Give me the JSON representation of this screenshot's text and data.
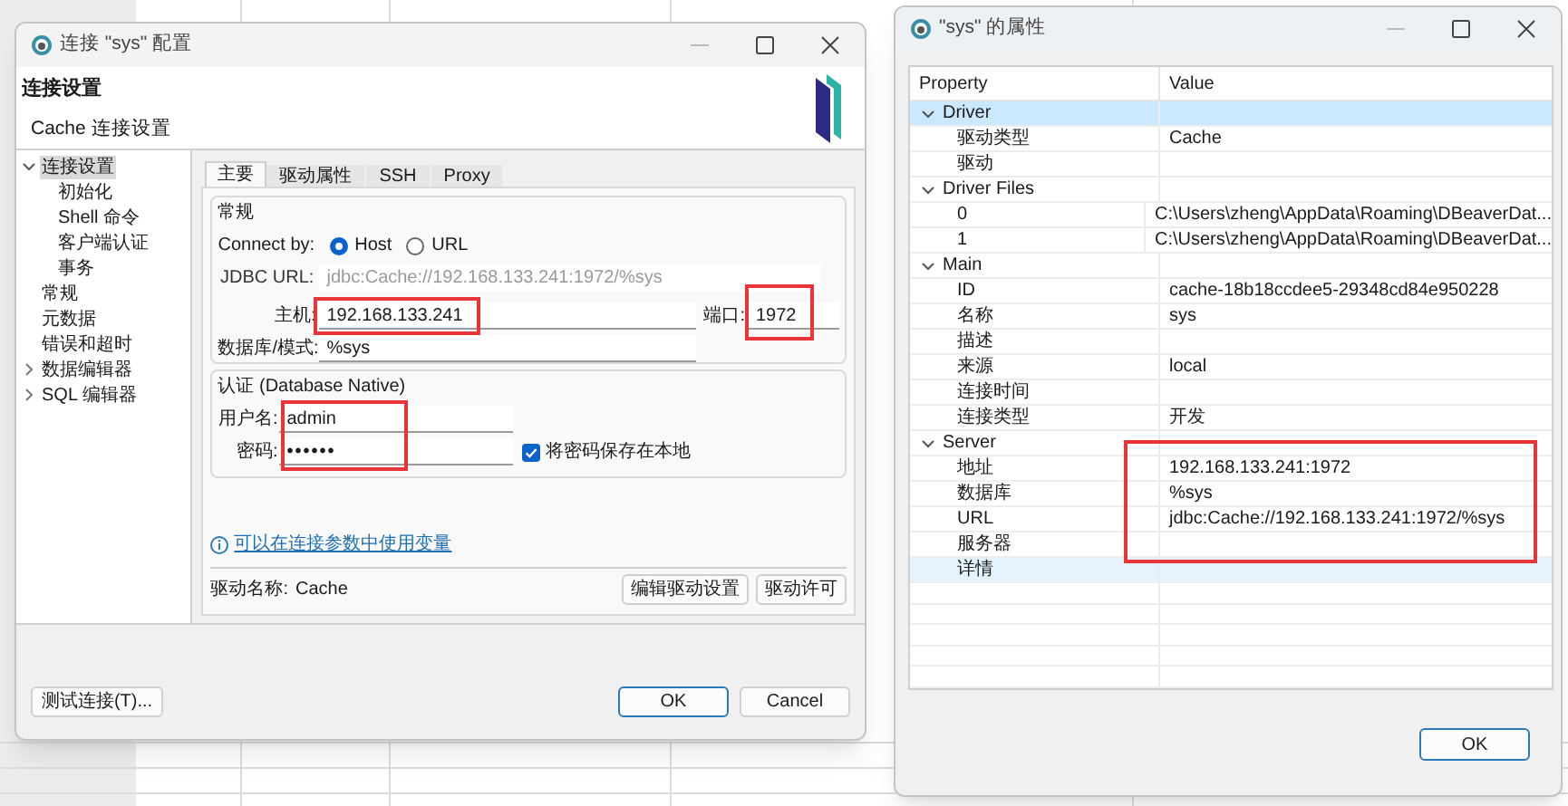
{
  "config_dialog": {
    "title": "连接 \"sys\" 配置",
    "header_title": "连接设置",
    "header_subtitle": "Cache 连接设置",
    "nav": [
      {
        "label": "连接设置",
        "expanded": true,
        "selected": true,
        "children": [
          {
            "label": "初始化",
            "selected": false
          },
          {
            "label": "Shell 命令",
            "selected": false
          },
          {
            "label": "客户端认证",
            "selected": false
          },
          {
            "label": "事务",
            "selected": false
          }
        ]
      },
      {
        "label": "常规",
        "selected": false
      },
      {
        "label": "元数据",
        "selected": false
      },
      {
        "label": "错误和超时",
        "selected": false
      },
      {
        "label": "数据编辑器",
        "expanded": false,
        "selected": false
      },
      {
        "label": "SQL 编辑器",
        "expanded": false,
        "selected": false
      }
    ],
    "tabs": [
      {
        "label": "主要",
        "selected": true
      },
      {
        "label": "驱动属性",
        "selected": false
      },
      {
        "label": "SSH",
        "selected": false
      },
      {
        "label": "Proxy",
        "selected": false
      }
    ],
    "general_group": {
      "title": "常规",
      "connect_by_label": "Connect by:",
      "connect_options": [
        {
          "label": "Host",
          "selected": true
        },
        {
          "label": "URL",
          "selected": false
        }
      ],
      "jdbc_url_label": "JDBC URL:",
      "jdbc_url": "jdbc:Cache://192.168.133.241:1972/%sys",
      "host_label": "主机:",
      "host": "192.168.133.241",
      "port_label": "端口:",
      "port": "1972",
      "database_label": "数据库/模式:",
      "database": "%sys"
    },
    "auth_group": {
      "title": "认证 (Database Native)",
      "username_label": "用户名:",
      "username": "admin",
      "password_label": "密码:",
      "password": "••••••",
      "save_password": {
        "label": "将密码保存在本地",
        "checked": true
      }
    },
    "variables_link": "可以在连接参数中使用变量",
    "driver_name_label": "驱动名称:",
    "driver_name": "Cache",
    "driver_buttons": [
      "编辑驱动设置",
      "驱动许可"
    ],
    "test_button": "测试连接(T)...",
    "buttons": [
      "OK",
      "Cancel"
    ]
  },
  "properties_dialog": {
    "title": "\"sys\" 的属性",
    "columns": [
      "Property",
      "Value"
    ],
    "groups": [
      {
        "name": "Driver",
        "expanded": true,
        "selected": true,
        "rows": [
          {
            "property": "驱动类型",
            "value": "Cache",
            "selected": false,
            "hovered": false
          },
          {
            "property": "驱动",
            "selected": false,
            "hovered": false
          }
        ]
      },
      {
        "name": "Driver Files",
        "expanded": true,
        "selected": false,
        "rows": [
          {
            "property": "0",
            "value": "C:\\Users\\zheng\\AppData\\Roaming\\DBeaverDat...",
            "selected": false,
            "hovered": false
          },
          {
            "property": "1",
            "value": "C:\\Users\\zheng\\AppData\\Roaming\\DBeaverDat...",
            "selected": false,
            "hovered": false
          }
        ]
      },
      {
        "name": "Main",
        "expanded": true,
        "selected": false,
        "rows": [
          {
            "property": "ID",
            "value": "cache-18b18ccdee5-29348cd84e950228",
            "selected": false,
            "hovered": false
          },
          {
            "property": "名称",
            "value": "sys",
            "selected": false,
            "hovered": false
          },
          {
            "property": "描述",
            "selected": false,
            "hovered": false
          },
          {
            "property": "来源",
            "value": "local",
            "selected": false,
            "hovered": false
          },
          {
            "property": "连接时间",
            "selected": false,
            "hovered": false
          },
          {
            "property": "连接类型",
            "value": "开发",
            "selected": false,
            "hovered": false
          }
        ]
      },
      {
        "name": "Server",
        "expanded": true,
        "selected": false,
        "rows": [
          {
            "property": "地址",
            "value": "192.168.133.241:1972",
            "selected": false,
            "hovered": false
          },
          {
            "property": "数据库",
            "value": "%sys",
            "selected": false,
            "hovered": false
          },
          {
            "property": "URL",
            "value": "jdbc:Cache://192.168.133.241:1972/%sys",
            "selected": false,
            "hovered": false
          },
          {
            "property": "服务器",
            "selected": false,
            "hovered": false
          },
          {
            "property": "详情",
            "selected": false,
            "hovered": true
          }
        ]
      }
    ],
    "ok_button": "OK"
  }
}
